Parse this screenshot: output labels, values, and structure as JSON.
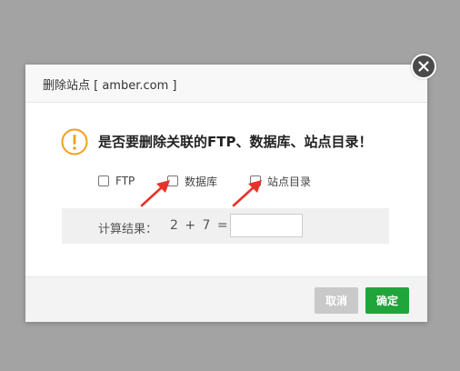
{
  "dialog": {
    "title": "删除站点 [ amber.com ]",
    "question": "是否要删除关联的FTP、数据库、站点目录！",
    "options": [
      {
        "label": "FTP",
        "checked": false
      },
      {
        "label": "数据库",
        "checked": false
      },
      {
        "label": "站点目录",
        "checked": false
      }
    ],
    "calc": {
      "label": "计算结果：",
      "expression": "2 + 7  =",
      "value": ""
    },
    "buttons": {
      "cancel": "取消",
      "confirm": "确定"
    }
  },
  "icons": {
    "close": "close-icon",
    "warning": "warning-icon",
    "arrow": "red-arrow-annotation"
  },
  "colors": {
    "confirm": "#20a53a",
    "cancel": "#c9c9c9",
    "warning": "#f0a020",
    "arrow": "#e8312a",
    "overlay": "#a3a3a3"
  }
}
